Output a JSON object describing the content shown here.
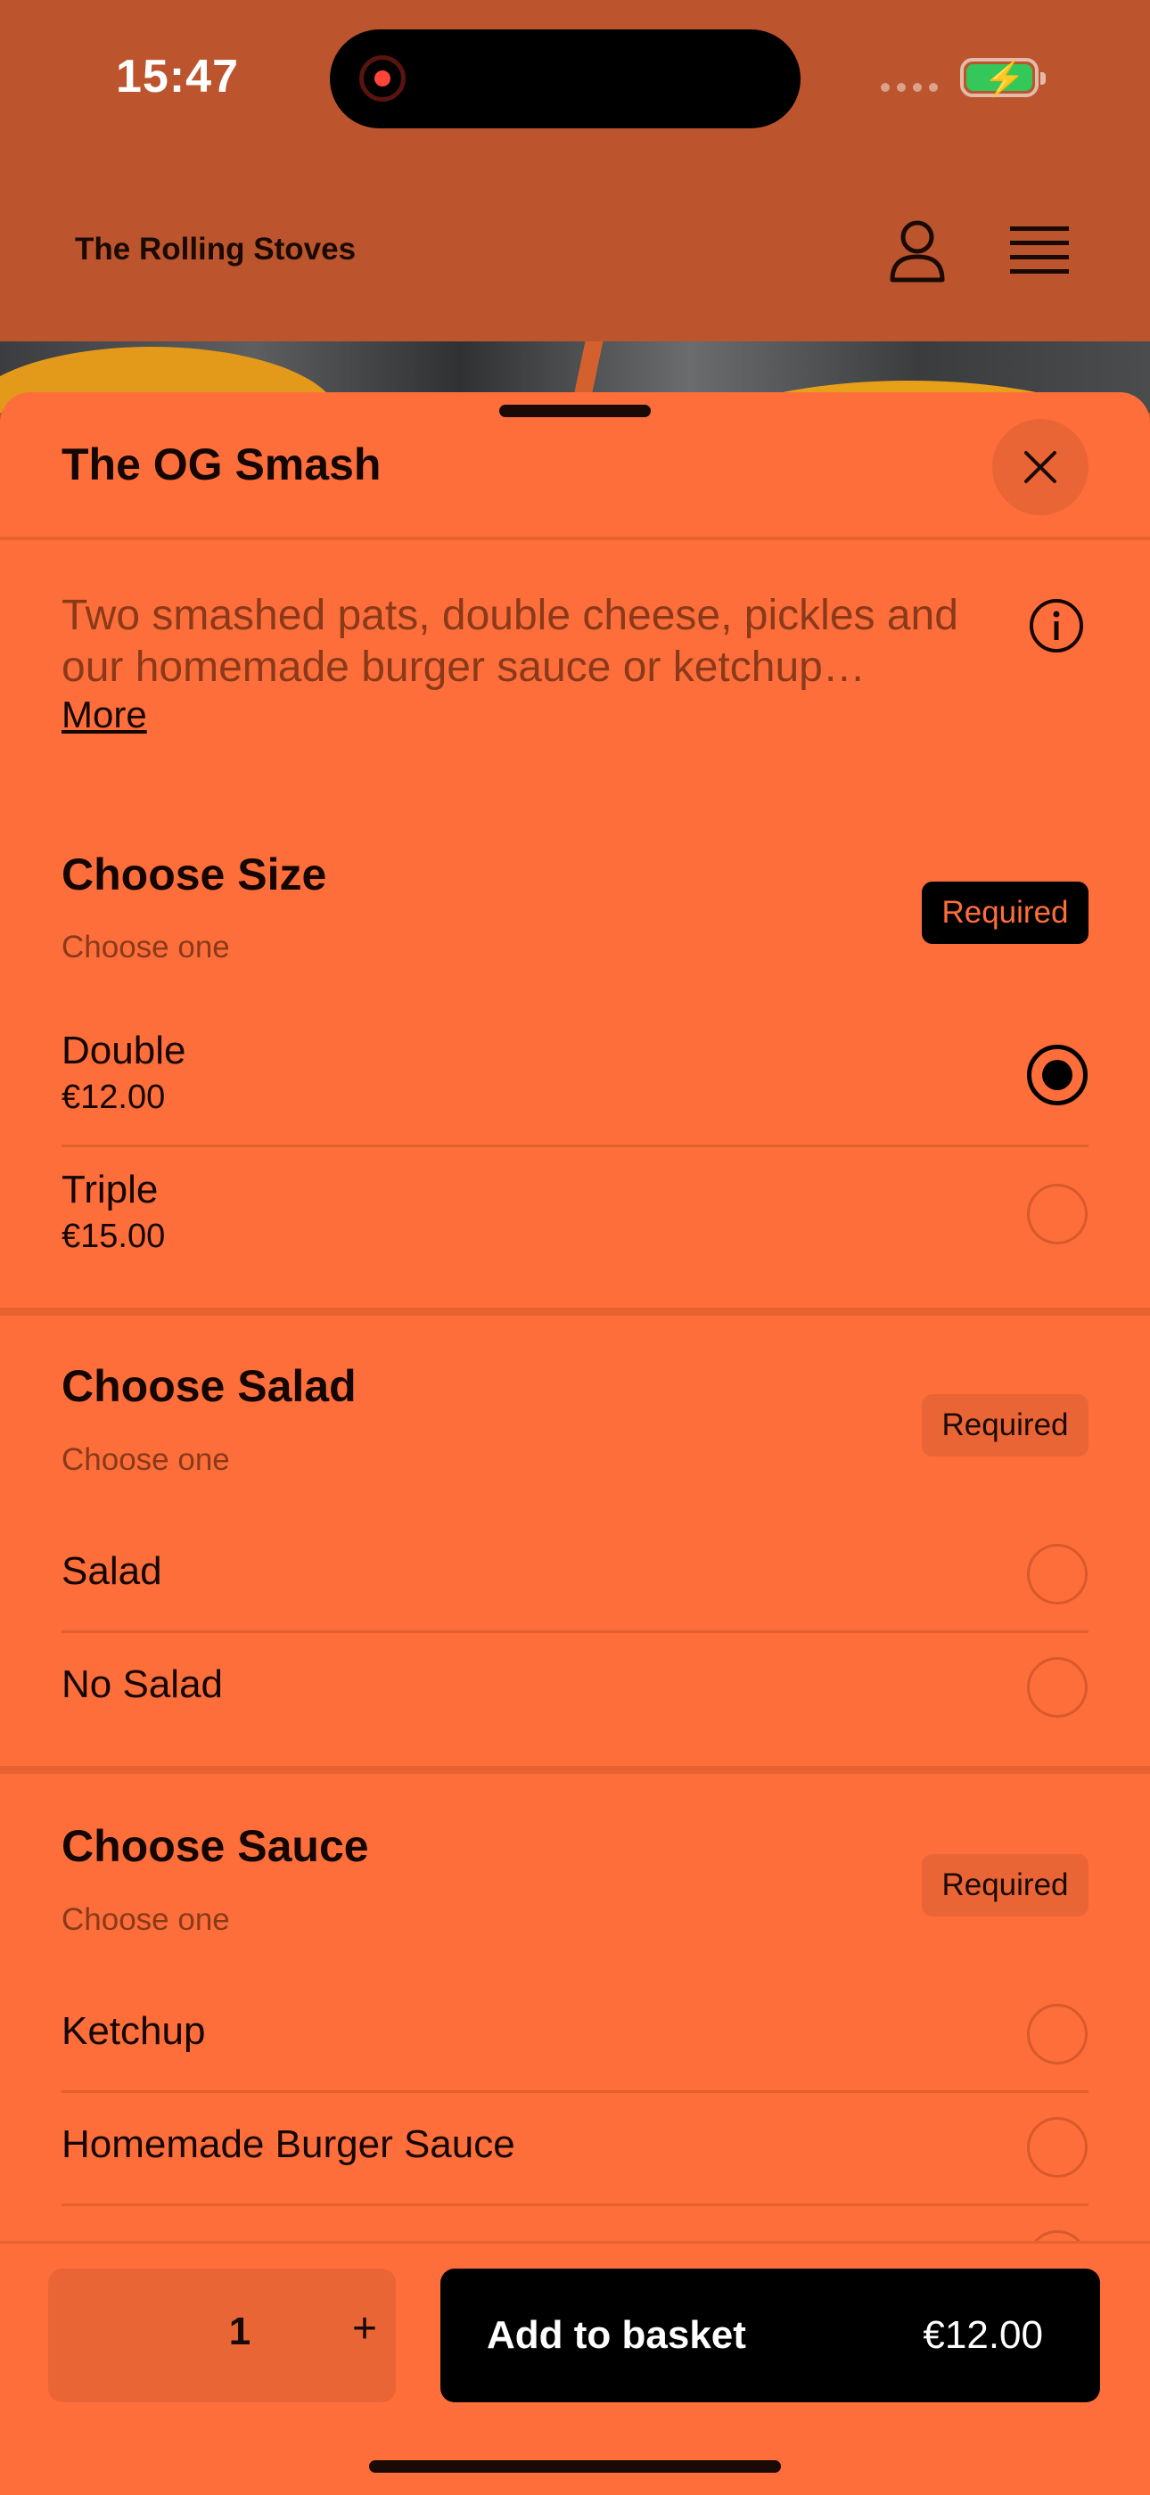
{
  "status_bar": {
    "time": "15:47"
  },
  "header": {
    "brand": "The Rolling Stoves"
  },
  "item": {
    "title": "The OG Smash",
    "description": "Two smashed pats, double cheese, pickles and our homemade burger sauce or ketchup…",
    "more_label": "More"
  },
  "sections": [
    {
      "title": "Choose Size",
      "subtitle": "Choose one",
      "badge": "Required",
      "options": [
        {
          "name": "Double",
          "price": "€12.00",
          "selected": true
        },
        {
          "name": "Triple",
          "price": "€15.00",
          "selected": false
        }
      ]
    },
    {
      "title": "Choose Salad",
      "subtitle": "Choose one",
      "badge": "Required",
      "options": [
        {
          "name": "Salad",
          "selected": false
        },
        {
          "name": "No Salad",
          "selected": false
        }
      ]
    },
    {
      "title": "Choose Sauce",
      "subtitle": "Choose one",
      "badge": "Required",
      "options": [
        {
          "name": "Ketchup",
          "selected": false
        },
        {
          "name": "Homemade Burger Sauce",
          "selected": false
        }
      ]
    }
  ],
  "footer": {
    "quantity": "1",
    "plus_label": "+",
    "add_label": "Add to basket",
    "total": "€12.00"
  },
  "colors": {
    "header_bg": "#BC552D",
    "sheet_bg": "#FE6E3A",
    "button_bg": "#000000"
  },
  "icons": [
    "record-icon",
    "signal-icon",
    "battery-icon",
    "account-icon",
    "menu-icon",
    "close-icon",
    "info-icon"
  ]
}
